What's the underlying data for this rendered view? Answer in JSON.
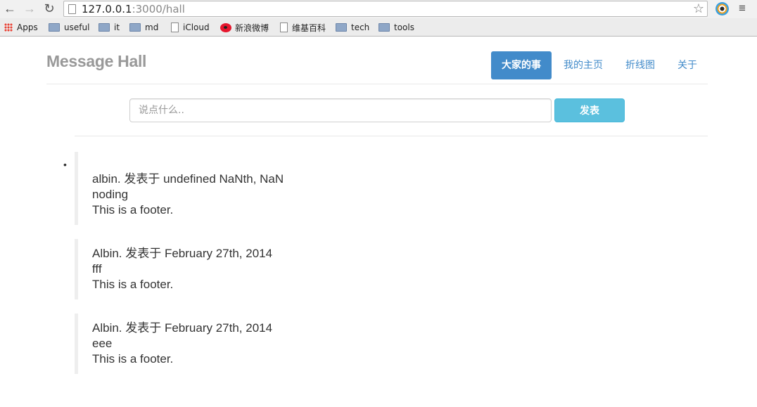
{
  "browser": {
    "url_host": "127.0.0.1",
    "url_rest": ":3000/hall",
    "bookmarks": [
      "Apps",
      "useful",
      "it",
      "md",
      "iCloud",
      "新浪微博",
      "维基百科",
      "tech",
      "tools"
    ]
  },
  "header": {
    "brand": "Message Hall",
    "tabs": [
      {
        "label": "大家的事",
        "active": true
      },
      {
        "label": "我的主页",
        "active": false
      },
      {
        "label": "折线图",
        "active": false
      },
      {
        "label": "关于",
        "active": false
      }
    ]
  },
  "compose": {
    "placeholder": "说点什么..",
    "value": "",
    "submit_label": "发表"
  },
  "messages": [
    {
      "header": "albin. 发表于 undefined NaNth, NaN",
      "body": "noding",
      "footer": "This is a footer."
    },
    {
      "header": "Albin. 发表于 February 27th, 2014",
      "body": "fff",
      "footer": "This is a footer."
    },
    {
      "header": "Albin. 发表于 February 27th, 2014",
      "body": "eee",
      "footer": "This is a footer."
    }
  ],
  "colors": {
    "primary": "#428bca",
    "info": "#5bc0de",
    "brand_text": "#999999"
  }
}
